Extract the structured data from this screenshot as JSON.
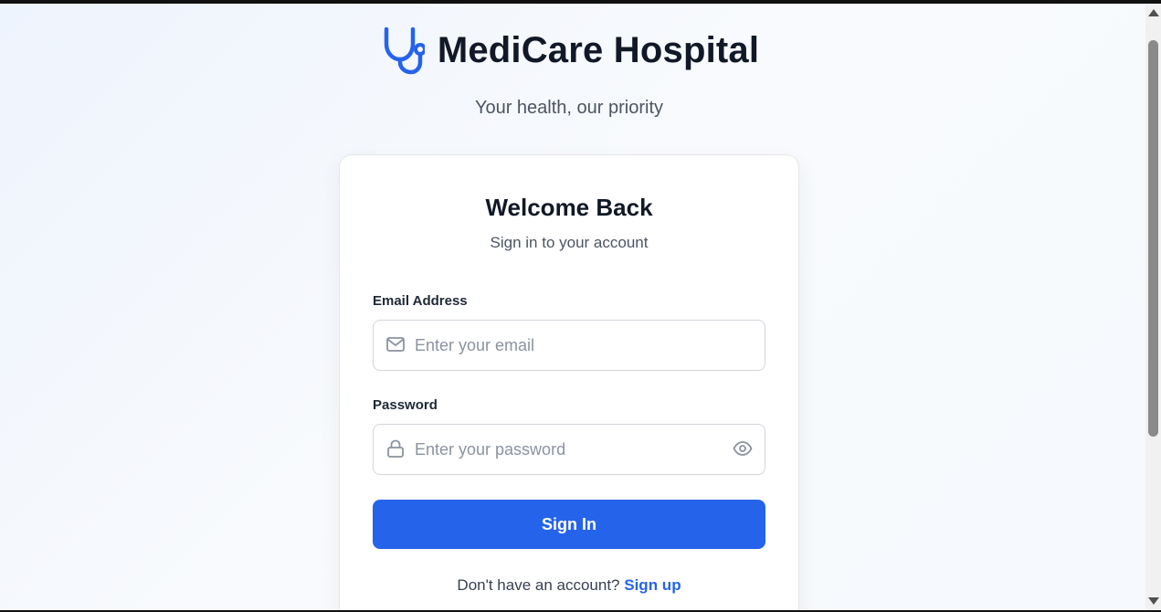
{
  "brand": {
    "title": "MediCare Hospital",
    "tagline": "Your health, our priority",
    "icon": "stethoscope-icon",
    "accent_color": "#2563eb"
  },
  "login_card": {
    "title": "Welcome Back",
    "subtitle": "Sign in to your account",
    "email": {
      "label": "Email Address",
      "placeholder": "Enter your email",
      "value": "",
      "icon": "mail-icon"
    },
    "password": {
      "label": "Password",
      "placeholder": "Enter your password",
      "value": "",
      "icon": "lock-icon",
      "toggle_icon": "eye-icon"
    },
    "submit_label": "Sign In",
    "signup_prompt": "Don't have an account?",
    "signup_link": "Sign up"
  }
}
